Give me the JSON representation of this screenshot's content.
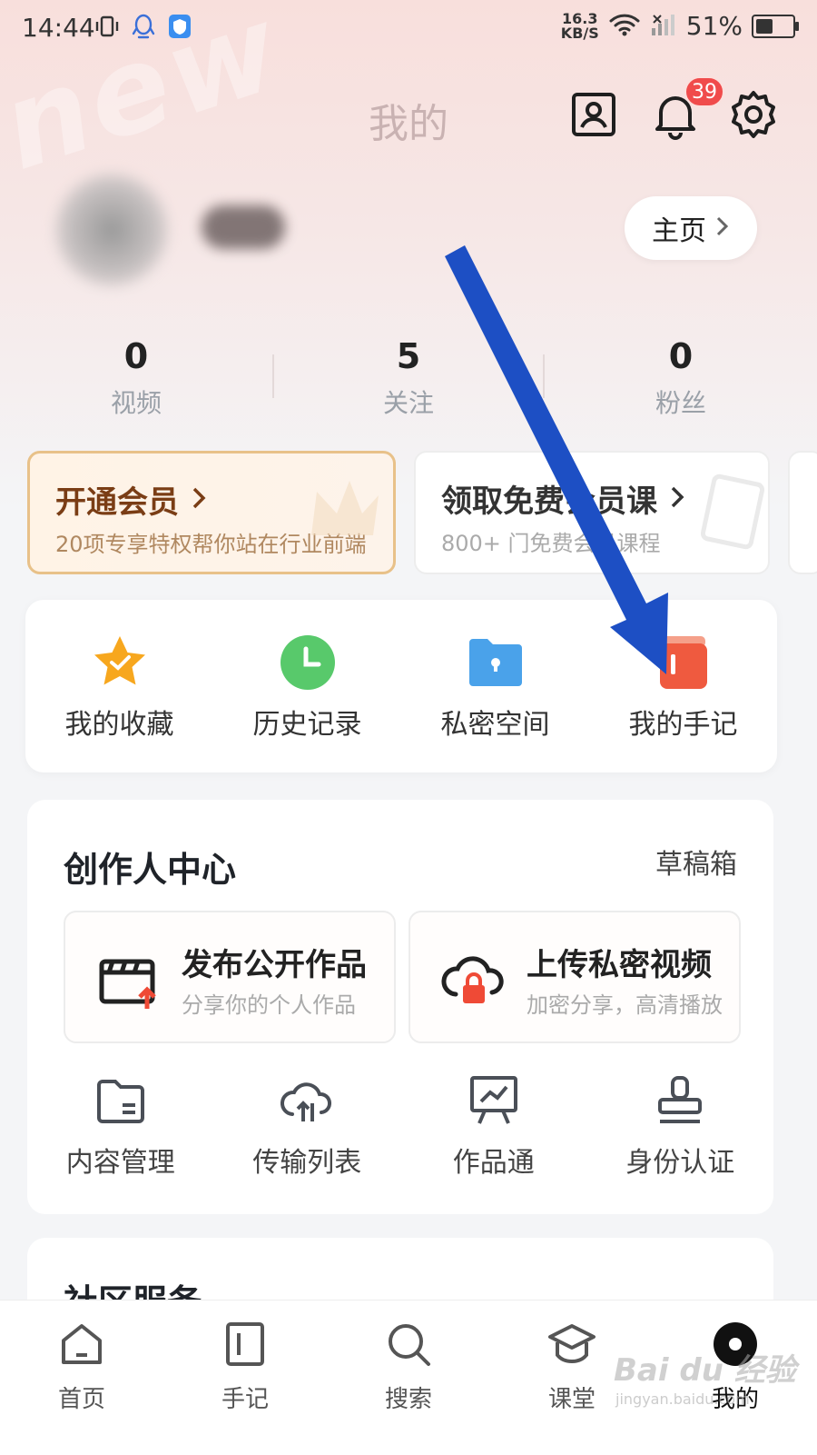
{
  "status_bar": {
    "time": "14:44",
    "net_speed_value": "16.3",
    "net_speed_unit": "KB/S",
    "battery": "51%",
    "battery_level": 0.51
  },
  "header": {
    "title": "我的",
    "notification_count": "39",
    "icons": [
      "contact-card-icon",
      "bell-icon",
      "gear-icon"
    ]
  },
  "profile": {
    "home_button": "主页"
  },
  "stats": [
    {
      "value": "0",
      "label": "视频"
    },
    {
      "value": "5",
      "label": "关注"
    },
    {
      "value": "0",
      "label": "粉丝"
    }
  ],
  "promo": [
    {
      "title": "开通会员",
      "subtitle": "20项专享特权帮你站在行业前端"
    },
    {
      "title": "领取免费会员课",
      "subtitle": "800+ 门免费会员课程"
    }
  ],
  "quick_actions": [
    {
      "label": "我的收藏",
      "icon": "star-icon"
    },
    {
      "label": "历史记录",
      "icon": "clock-icon"
    },
    {
      "label": "私密空间",
      "icon": "lock-folder-icon"
    },
    {
      "label": "我的手记",
      "icon": "notebook-icon"
    }
  ],
  "creator": {
    "title": "创作人中心",
    "drafts": "草稿箱",
    "publish": [
      {
        "title": "发布公开作品",
        "subtitle": "分享你的个人作品"
      },
      {
        "title": "上传私密视频",
        "subtitle": "加密分享，高清播放"
      }
    ],
    "tools": [
      {
        "label": "内容管理",
        "icon": "folder-icon"
      },
      {
        "label": "传输列表",
        "icon": "cloud-upload-icon"
      },
      {
        "label": "作品通",
        "icon": "presentation-chart-icon"
      },
      {
        "label": "身份认证",
        "icon": "stamp-icon"
      }
    ]
  },
  "community": {
    "title": "社区服务"
  },
  "bottom_nav": [
    {
      "label": "首页",
      "icon": "home-icon"
    },
    {
      "label": "手记",
      "icon": "note-icon"
    },
    {
      "label": "搜索",
      "icon": "search-icon"
    },
    {
      "label": "课堂",
      "icon": "graduation-cap-icon"
    },
    {
      "label": "我的",
      "icon": "profile-dot-icon"
    }
  ],
  "watermark": {
    "logo": "Bai du 经验",
    "url": "jingyan.baidu.com"
  },
  "colors": {
    "accent_blue": "#1d4fc4",
    "badge_red": "#f04b4b",
    "vip_brown": "#7a3d15"
  }
}
